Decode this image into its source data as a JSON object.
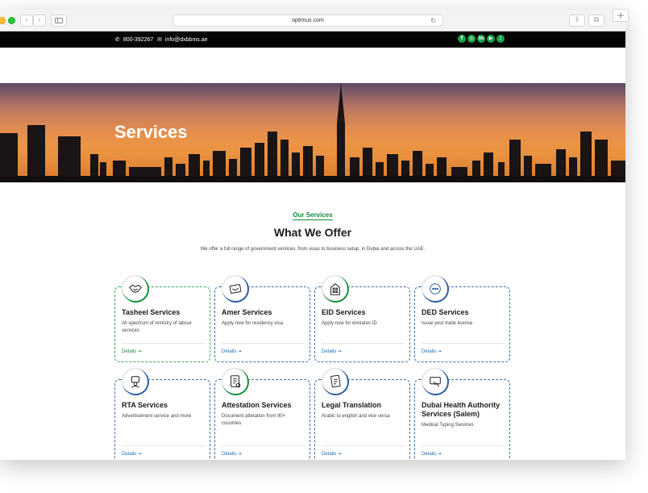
{
  "browser": {
    "url": "optimus.com",
    "back": "‹",
    "forward": "›",
    "reload": "↻",
    "share": "⇪",
    "tabs": "⧉",
    "new_tab": "+"
  },
  "topbar": {
    "phone": "800-392267",
    "email": "info@dxbbms.ae",
    "socials": [
      {
        "name": "facebook-icon",
        "glyph": "f"
      },
      {
        "name": "instagram-icon",
        "glyph": "◎"
      },
      {
        "name": "linkedin-icon",
        "glyph": "in"
      },
      {
        "name": "youtube-icon",
        "glyph": "▶"
      },
      {
        "name": "tiktok-icon",
        "glyph": "♪"
      }
    ]
  },
  "hero": {
    "title": "Services"
  },
  "section": {
    "kicker": "Our Services",
    "heading": "What We Offer",
    "intro": "We offer a full range of government services, from visas to business setup, in Dubai and across the UAE."
  },
  "cards": [
    {
      "icon": "handshake-icon",
      "title": "Tasheel Services",
      "desc": "All spectrum of ministry of labour services",
      "details": "Details ➞"
    },
    {
      "icon": "passport-icon",
      "title": "Amer Services",
      "desc": "Apply now for residency visa",
      "details": "Details ➞"
    },
    {
      "icon": "building-icon",
      "title": "EID Services",
      "desc": "Apply now for emirates ID",
      "details": "Details ➞"
    },
    {
      "icon": "chat-icon",
      "title": "DED Services",
      "desc": "Issue your trade license",
      "details": "Details ➞"
    },
    {
      "icon": "agent-icon",
      "title": "RTA Services",
      "desc": "Advertisement service and more",
      "details": "Details ➞"
    },
    {
      "icon": "document-stamp-icon",
      "title": "Attestation Services",
      "desc": "Document attetation from 90+ countries",
      "details": "Details ➞"
    },
    {
      "icon": "translate-document-icon",
      "title": "Legal Translation",
      "desc": "Arabic to english and vice versa",
      "details": "Details ➞"
    },
    {
      "icon": "health-card-icon",
      "title": "Dubai Health Authority Services (Salem)",
      "desc": "Medical Typing Services",
      "details": "Details ➞"
    }
  ],
  "colors": {
    "accent_green": "#128c3a",
    "accent_blue": "#1a6eb5",
    "topbar_bg": "#050505"
  }
}
